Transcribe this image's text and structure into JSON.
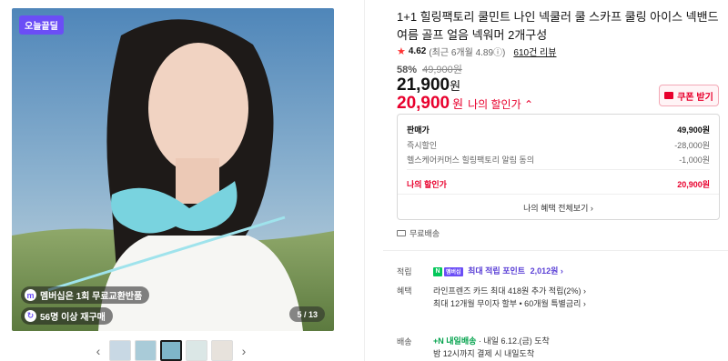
{
  "gallery": {
    "badge": "오늘끝딜",
    "pill1": "멤버십은 1회 무료교환반품",
    "pill2": "56명 이상 재구매",
    "counter": "5 / 13",
    "prev": "‹",
    "next": "›"
  },
  "product": {
    "title": "1+1 힐링팩토리 쿨민트 나인 넥쿨러 쿨 스카프 쿨링 아이스 넥밴드 여름 골프 얼음 넥워머 2개구성",
    "rating": "4.62",
    "rating_detail": "(최근 6개월 4.89ⓘ)",
    "reviews": "610건 리뷰",
    "discount_pct": "58%",
    "original_price": "49,900원",
    "price": "21,900",
    "price_unit": "원",
    "my_price": "20,900",
    "my_price_unit": "원",
    "my_price_label": "나의 할인가 ⌃",
    "coupon_label": "쿠폰 받기"
  },
  "price_box": {
    "sale_label": "판매가",
    "sale_value": "49,900원",
    "instant_label": "즉시할인",
    "instant_value": "-28,000원",
    "alert_label": "헬스케어커머스 힐링팩토리 알림 동의",
    "alert_value": "-1,000원",
    "my_label": "나의 할인가",
    "my_value": "20,900원",
    "all_benefits": "나의 혜택 전체보기 ›"
  },
  "shipping": {
    "free": "무료배송"
  },
  "benefits": {
    "points_label": "적립",
    "n_badge": "N",
    "membership_badge": "멤버십",
    "points_text": "최대 적립 포인트",
    "points_value": "2,012원 ›",
    "perks_label": "혜택",
    "perk1": "라인프렌즈 카드 최대 418원 추가 적립(2%) ›",
    "perk2": "최대 12개월 무이자 할부 • 60개월 특별금리 ›",
    "delivery_label": "배송",
    "tomorrow_badge": "+N 내일배송",
    "delivery_date": "· 내일 6.12.(금) 도착",
    "delivery_note": "밤 12시까지 결제 시 내일도착"
  }
}
